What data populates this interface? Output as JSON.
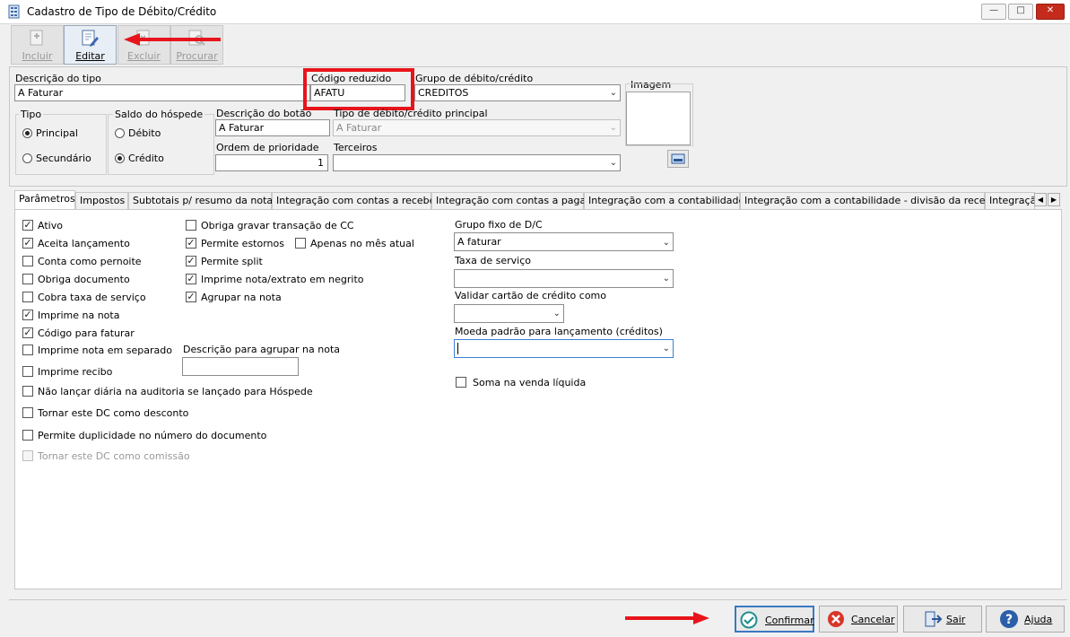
{
  "window": {
    "title": "Cadastro de Tipo de Débito/Crédito"
  },
  "toolbar": {
    "incluir": "Incluir",
    "editar": "Editar",
    "excluir": "Excluir",
    "procurar": "Procurar"
  },
  "header": {
    "descricao_tipo_label": "Descrição do tipo",
    "descricao_tipo_value": "A Faturar",
    "codigo_reduzido_label": "Código reduzido",
    "codigo_reduzido_value": "AFATU",
    "grupo_label": "Grupo de débito/crédito",
    "grupo_value": "CREDITOS",
    "imagem_label": "Imagem",
    "tipo_label": "Tipo",
    "tipo_principal": "Principal",
    "tipo_secundario": "Secundário",
    "saldo_label": "Saldo do hóspede",
    "saldo_debito": "Débito",
    "saldo_credito": "Crédito",
    "descricao_botao_label": "Descrição do botão",
    "descricao_botao_value": "A Faturar",
    "tipo_principal_label": "Tipo de débito/crédito principal",
    "tipo_principal_value": "A Faturar",
    "ordem_label": "Ordem de prioridade",
    "ordem_value": "1",
    "terceiros_label": "Terceiros",
    "terceiros_value": ""
  },
  "tabs": [
    "Parâmetros",
    "Impostos",
    "Subtotais p/ resumo da nota",
    "Integração com contas a receber",
    "Integração com contas a pagar",
    "Integração com a contabilidade",
    "Integração com a contabilidade - divisão da receita",
    "Integraçã"
  ],
  "params": {
    "col1": [
      {
        "label": "Ativo",
        "checked": true
      },
      {
        "label": "Aceita lançamento",
        "checked": true
      },
      {
        "label": "Conta como pernoite",
        "checked": false
      },
      {
        "label": "Obriga documento",
        "checked": false
      },
      {
        "label": "Cobra taxa de serviço",
        "checked": false
      },
      {
        "label": "Imprime na nota",
        "checked": true
      },
      {
        "label": "Código para faturar",
        "checked": true
      },
      {
        "label": "Imprime nota em separado",
        "checked": false
      },
      {
        "label": "Imprime recibo",
        "checked": false
      },
      {
        "label": "Não lançar diária na auditoria se lançado para Hóspede",
        "checked": false
      },
      {
        "label": "Tornar este DC como desconto",
        "checked": false
      },
      {
        "label": "Permite duplicidade no número do documento",
        "checked": false
      },
      {
        "label": "Tornar este DC como comissão",
        "checked": false,
        "disabled": true
      }
    ],
    "col2": [
      {
        "label": "Obriga gravar transação de CC",
        "checked": false
      },
      {
        "label": "Permite estornos",
        "checked": true
      },
      {
        "label": "Apenas no mês atual",
        "checked": false
      },
      {
        "label": "Permite split",
        "checked": true
      },
      {
        "label": "Imprime nota/extrato em negrito",
        "checked": true
      },
      {
        "label": "Agrupar na nota",
        "checked": true
      }
    ],
    "descricao_agrupar_label": "Descrição para agrupar na nota",
    "descricao_agrupar_value": "",
    "grupo_fixo_label": "Grupo fixo de D/C",
    "grupo_fixo_value": "A faturar",
    "taxa_servico_label": "Taxa de serviço",
    "taxa_servico_value": "",
    "validar_cartao_label": "Validar cartão de crédito como",
    "validar_cartao_value": "",
    "moeda_label": "Moeda padrão para lançamento (créditos)",
    "moeda_value": "",
    "soma_venda_label": "Soma na venda líquida",
    "soma_venda_checked": false
  },
  "footer": {
    "confirmar": "Confirmar",
    "cancelar": "Cancelar",
    "sair": "Sair",
    "ajuda": "Ajuda"
  },
  "colors": {
    "highlight_box": "#e8141b",
    "arrow": "#e8141b"
  }
}
